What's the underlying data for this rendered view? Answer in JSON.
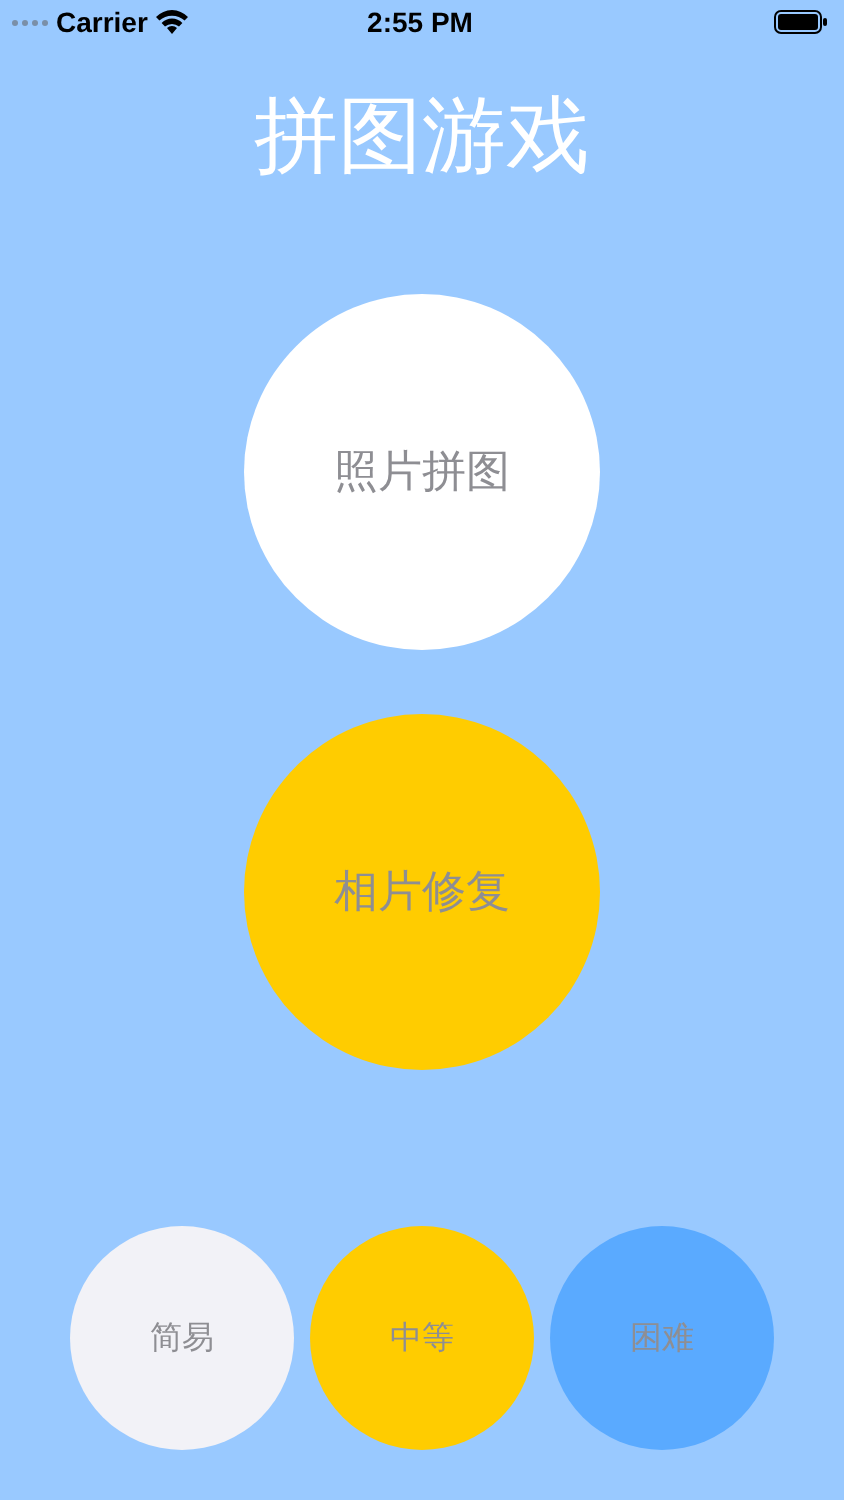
{
  "status_bar": {
    "carrier": "Carrier",
    "time": "2:55 PM"
  },
  "title": "拼图游戏",
  "modes": [
    {
      "label": "照片拼图",
      "color": "#ffffff"
    },
    {
      "label": "相片修复",
      "color": "#ffcc00"
    }
  ],
  "difficulty": [
    {
      "label": "简易",
      "color": "#f2f2f7"
    },
    {
      "label": "中等",
      "color": "#ffcc00"
    },
    {
      "label": "困难",
      "color": "#5aaaff"
    }
  ]
}
